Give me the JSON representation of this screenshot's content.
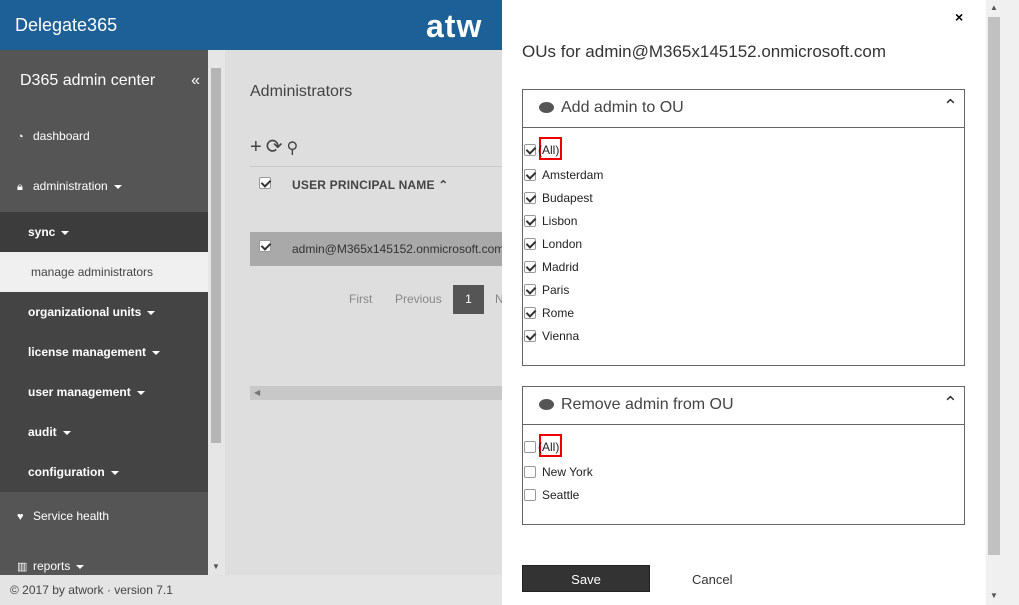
{
  "app": {
    "brand": "Delegate365",
    "logo_text": "atw",
    "footer": "© 2017 by atwork · version 7.1"
  },
  "sidebar": {
    "header": "D365 admin center",
    "collapse": "«",
    "items": [
      {
        "label": "dashboard",
        "icon": "dashboard-icon"
      },
      {
        "label": "administration",
        "icon": "lock-icon"
      }
    ],
    "sub": [
      {
        "label": "sync"
      },
      {
        "label": "manage administrators"
      },
      {
        "label": "organizational units"
      },
      {
        "label": "license management"
      },
      {
        "label": "user management"
      },
      {
        "label": "audit"
      },
      {
        "label": "configuration"
      }
    ],
    "service_health": "Service health",
    "reports": "reports"
  },
  "main": {
    "title": "Administrators",
    "column_header": "USER PRINCIPAL NAME",
    "row_value": "admin@M365x145152.onmicrosoft.com",
    "pager": {
      "first": "First",
      "previous": "Previous",
      "current": "1",
      "next": "N"
    }
  },
  "panel": {
    "title": "OUs for admin@M365x145152.onmicrosoft.com",
    "add_section": {
      "title": "Add admin to OU",
      "all_label": "(All)",
      "all_checked": true,
      "options": [
        {
          "label": "Amsterdam",
          "checked": true
        },
        {
          "label": "Budapest",
          "checked": true
        },
        {
          "label": "Lisbon",
          "checked": true
        },
        {
          "label": "London",
          "checked": true
        },
        {
          "label": "Madrid",
          "checked": true
        },
        {
          "label": "Paris",
          "checked": true
        },
        {
          "label": "Rome",
          "checked": true
        },
        {
          "label": "Vienna",
          "checked": true
        }
      ]
    },
    "remove_section": {
      "title": "Remove admin from OU",
      "all_label": "(All)",
      "all_checked": false,
      "options": [
        {
          "label": "New York",
          "checked": false
        },
        {
          "label": "Seattle",
          "checked": false
        }
      ]
    },
    "save_label": "Save",
    "cancel_label": "Cancel",
    "close_label": "×"
  }
}
